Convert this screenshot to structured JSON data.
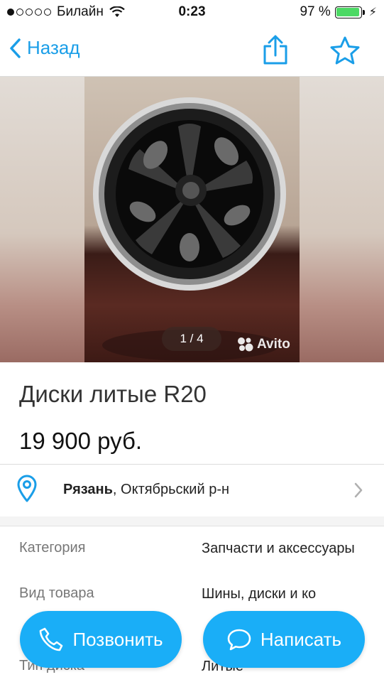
{
  "status_bar": {
    "carrier": "Билайн",
    "time": "0:23",
    "battery_percent": "97 %",
    "battery_level": 0.97,
    "signal_bars": 1
  },
  "nav": {
    "back_label": "Назад",
    "share_icon": "share-icon",
    "favorite_icon": "star-icon"
  },
  "gallery": {
    "counter": "1 / 4",
    "watermark": "Avito"
  },
  "listing": {
    "title": "Диски литые R20",
    "price": "19 900 руб."
  },
  "location": {
    "city": "Рязань",
    "district": ", Октябрьский р-н"
  },
  "params": [
    {
      "label": "Категория",
      "value": "Запчасти и аксессуары"
    },
    {
      "label": "Вид товара",
      "value": "Шины, диски и ко"
    },
    {
      "label": "Тип диска",
      "value": "Литые"
    }
  ],
  "actions": {
    "call_label": "Позвонить",
    "write_label": "Написать"
  },
  "colors": {
    "accent": "#1aaef7",
    "link": "#1a9ee8"
  }
}
